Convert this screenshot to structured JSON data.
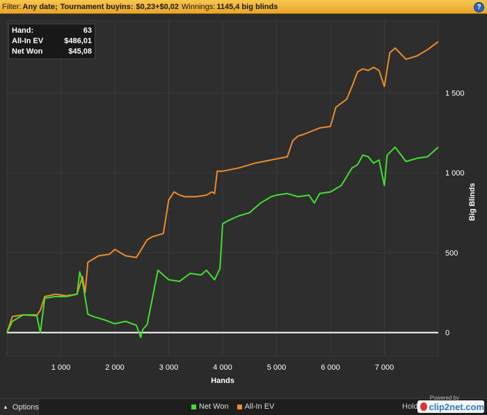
{
  "filter": {
    "label": "Filter:",
    "date_value": "Any date;",
    "buyins_label": "Tournament buyins:",
    "buyins_value": "$0,23+$0,02",
    "winnings_label": "Winnings:",
    "winnings_value": "1145,4 big blinds"
  },
  "help_icon": "?",
  "infobox": {
    "rows": [
      {
        "label": "Hand:",
        "value": "63"
      },
      {
        "label": "All-In EV",
        "value": "$486,01"
      },
      {
        "label": "Net Won",
        "value": "$45,08"
      }
    ]
  },
  "bottom": {
    "options_label": "Options",
    "brand_powered": "Powered by",
    "brand_hold": "Hold",
    "brand_logo": "clip2net.com"
  },
  "colors": {
    "net_won": "#41e030",
    "all_in_ev": "#ef8c2c",
    "zero_line": "#ffffff",
    "grid": "#3a3a3a",
    "background": "#2b2b2b"
  },
  "chart_data": {
    "type": "line",
    "xlabel": "Hands",
    "ylabel": "Big Blinds",
    "xlim": [
      0,
      8000
    ],
    "ylim": [
      -150,
      1950
    ],
    "xticks": [
      1000,
      2000,
      3000,
      4000,
      5000,
      6000,
      7000
    ],
    "xtick_labels": [
      "1 000",
      "2 000",
      "3 000",
      "4 000",
      "5 000",
      "6 000",
      "7 000"
    ],
    "yticks": [
      0,
      500,
      1000,
      1500
    ],
    "ytick_labels": [
      "0",
      "500",
      "1 000",
      "1 500"
    ],
    "grid": true,
    "legend_position": "bottom",
    "series": [
      {
        "name": "Net Won",
        "color": "#41e030",
        "x": [
          0,
          100,
          300,
          550,
          620,
          700,
          900,
          1100,
          1300,
          1350,
          1400,
          1500,
          1600,
          1800,
          2000,
          2200,
          2400,
          2480,
          2520,
          2600,
          2700,
          2800,
          3000,
          3200,
          3400,
          3600,
          3700,
          3850,
          3950,
          4000,
          4100,
          4300,
          4500,
          4700,
          4900,
          5000,
          5200,
          5400,
          5600,
          5700,
          5800,
          6000,
          6200,
          6400,
          6500,
          6600,
          6700,
          6800,
          6900,
          7000,
          7050,
          7200,
          7400,
          7600,
          7800,
          8000
        ],
        "values": [
          0,
          70,
          110,
          110,
          0,
          215,
          225,
          225,
          240,
          380,
          320,
          115,
          100,
          80,
          55,
          70,
          45,
          -30,
          20,
          50,
          220,
          390,
          330,
          320,
          370,
          360,
          390,
          330,
          400,
          680,
          700,
          730,
          750,
          810,
          850,
          860,
          870,
          850,
          860,
          810,
          870,
          880,
          920,
          1030,
          1050,
          1110,
          1100,
          1060,
          1080,
          920,
          1110,
          1160,
          1070,
          1090,
          1100,
          1160
        ]
      },
      {
        "name": "All-In EV",
        "color": "#ef8c2c",
        "x": [
          0,
          100,
          300,
          550,
          620,
          700,
          900,
          1100,
          1300,
          1400,
          1450,
          1500,
          1700,
          1900,
          2000,
          2200,
          2400,
          2600,
          2700,
          2900,
          3000,
          3100,
          3200,
          3300,
          3500,
          3700,
          3800,
          3850,
          3900,
          4000,
          4300,
          4600,
          4900,
          5200,
          5300,
          5400,
          5500,
          5800,
          6000,
          6100,
          6300,
          6400,
          6500,
          6600,
          6700,
          6800,
          6900,
          7000,
          7100,
          7200,
          7400,
          7600,
          7800,
          8000
        ],
        "values": [
          0,
          100,
          110,
          105,
          140,
          225,
          240,
          230,
          240,
          350,
          250,
          440,
          480,
          490,
          520,
          480,
          470,
          580,
          600,
          620,
          830,
          880,
          860,
          850,
          850,
          860,
          880,
          870,
          1010,
          1010,
          1030,
          1060,
          1080,
          1100,
          1200,
          1230,
          1240,
          1280,
          1290,
          1410,
          1460,
          1540,
          1630,
          1650,
          1640,
          1660,
          1640,
          1540,
          1750,
          1780,
          1710,
          1730,
          1770,
          1820
        ]
      }
    ]
  }
}
